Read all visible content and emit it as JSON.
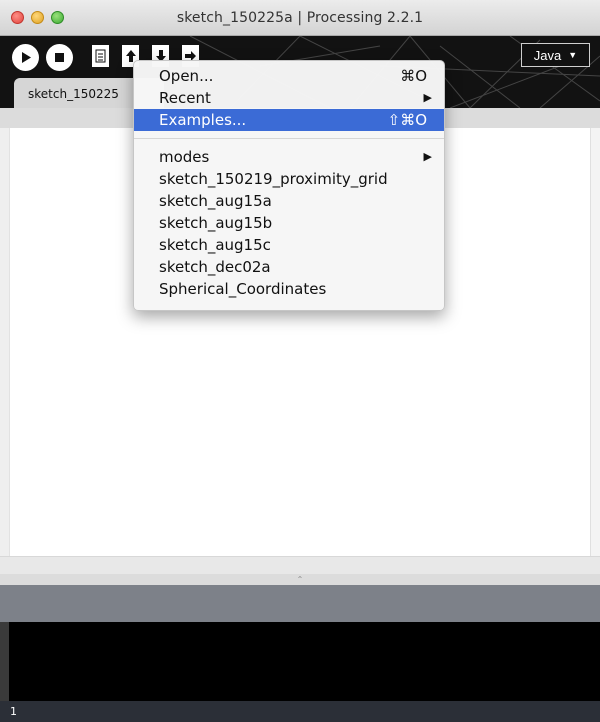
{
  "window": {
    "title": "sketch_150225a | Processing 2.2.1"
  },
  "toolbar": {
    "buttons": [
      {
        "icon": "run-icon"
      },
      {
        "icon": "stop-icon"
      },
      {
        "icon": "new-icon"
      },
      {
        "icon": "open-icon"
      },
      {
        "icon": "save-icon"
      },
      {
        "icon": "export-icon"
      }
    ],
    "mode_label": "Java",
    "mode_arrow": "▼"
  },
  "tabs": [
    {
      "label": "sketch_150225"
    }
  ],
  "menu": {
    "items": [
      {
        "label": "Open...",
        "shortcut": "⌘O"
      },
      {
        "label": "Recent",
        "submenu": "▶"
      },
      {
        "label": "Examples...",
        "shortcut": "⇧⌘O",
        "selected": true
      }
    ],
    "recent": [
      {
        "label": "modes",
        "submenu": "▶"
      },
      {
        "label": "sketch_150219_proximity_grid"
      },
      {
        "label": "sketch_aug15a"
      },
      {
        "label": "sketch_aug15b"
      },
      {
        "label": "sketch_aug15c"
      },
      {
        "label": "sketch_dec02a"
      },
      {
        "label": "Spherical_Coordinates"
      }
    ]
  },
  "editor": {
    "divider_glyph": "⌃"
  },
  "footer": {
    "line_number": "1"
  },
  "colors": {
    "menu_highlight": "#3b6bd6",
    "toolbar_bg": "#121212",
    "status_bar": "#7d8189"
  }
}
